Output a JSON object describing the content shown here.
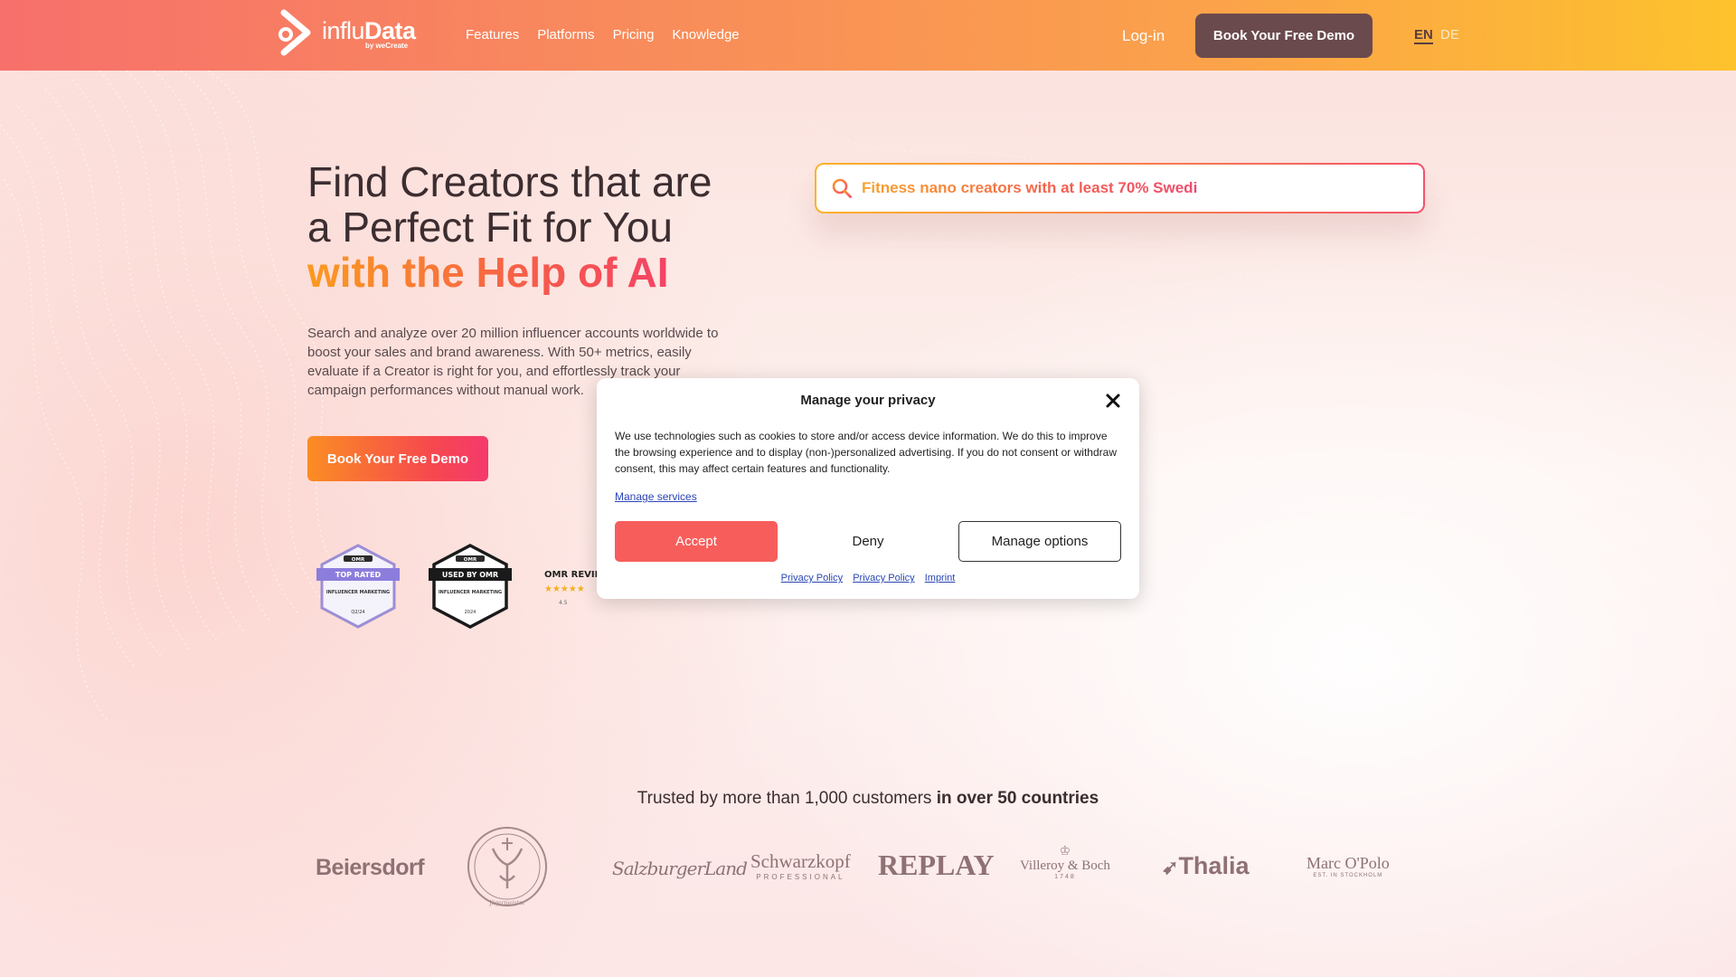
{
  "header": {
    "logo_name_light": "influ",
    "logo_name_bold": "Data",
    "logo_sub": "by weCreate",
    "nav": [
      "Features",
      "Platforms",
      "Pricing",
      "Knowledge"
    ],
    "login": "Log-in",
    "demo_button": "Book Your Free Demo",
    "lang_en": "EN",
    "lang_de": "DE"
  },
  "hero": {
    "title_line1": "Find Creators that are",
    "title_line2": "a Perfect Fit for You",
    "title_line3": "with the Help of AI",
    "description": "Search and analyze over 20 million influencer accounts worldwide to boost your sales and brand awareness. With 50+ metrics, easily evaluate if a Creator is right for you, and effortlessly track your campaign performances without manual work.",
    "button": "Book Your Free Demo"
  },
  "search": {
    "text": "Fitness nano creators with at least 70% Swedi"
  },
  "badges": {
    "badge1_top": "OMR",
    "badge1_ribbon": "TOP RATED",
    "badge1_text": "INFLUENCER MARKETING",
    "badge1_date": "Q2/24",
    "badge2_top": "OMR",
    "badge2_ribbon": "USED BY OMR",
    "badge2_text": "INFLUENCER MARKETING",
    "badge2_date": "2024",
    "badge3_brand": "OMR REVIEWS",
    "badge3_rating": "4.5"
  },
  "privacy_modal": {
    "title": "Manage your privacy",
    "body": "We use technologies such as cookies to store and/or access device information. We do this to improve the browsing experience and to display (non-)personalized advertising. If you do not consent or withdraw consent, this may affect certain features and functionality.",
    "manage_services": "Manage services",
    "accept": "Accept",
    "deny": "Deny",
    "manage_options": "Manage options",
    "links": [
      "Privacy Policy",
      "Privacy Policy",
      "Imprint"
    ]
  },
  "trusted": {
    "text": "Trusted by more than 1,000 customers",
    "bold": "in over 50 countries",
    "brands": [
      "Beiersdorf",
      "Jägermeister",
      "SalzburgerLand",
      "Schwarzkopf",
      "PROFESSIONAL",
      "REPLAY",
      "Villeroy & Boch",
      "1748",
      "Thalia",
      "Marc O'Polo",
      "EST. IN STOCKHOLM"
    ]
  },
  "colors": {
    "header_start": "#f7706b",
    "header_end": "#fdc22c",
    "accent": "#f75e5b",
    "demo_button": "#6b4a4e"
  }
}
